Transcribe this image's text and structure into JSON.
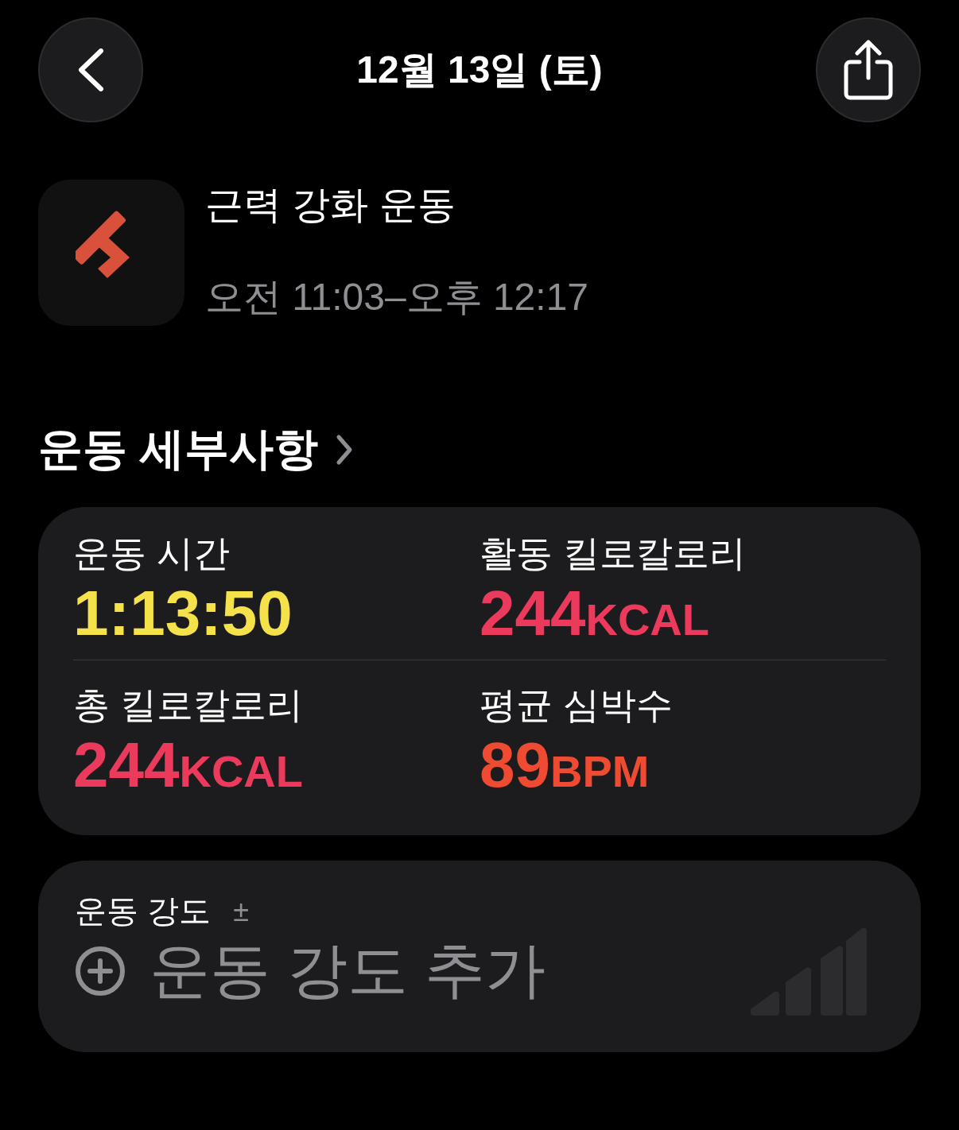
{
  "header": {
    "title": "12월 13일 (토)"
  },
  "workout": {
    "name": "근력 강화 운동",
    "time_range": "오전 11:03–오후 12:17"
  },
  "details": {
    "title": "운동 세부사항",
    "metrics": [
      {
        "label": "운동 시간",
        "value": "1:13:50",
        "color": "#f5e14a"
      },
      {
        "label": "활동 킬로칼로리",
        "value": "244",
        "unit": "KCAL",
        "color": "#ec3a5c"
      },
      {
        "label": "총 킬로칼로리",
        "value": "244",
        "unit": "KCAL",
        "color": "#ec3a5c"
      },
      {
        "label": "평균 심박수",
        "value": "89",
        "unit": "BPM",
        "color": "#ee4b32"
      }
    ]
  },
  "effort": {
    "label": "운동 강도",
    "symbol": "±",
    "action": "운동 강도 추가"
  }
}
